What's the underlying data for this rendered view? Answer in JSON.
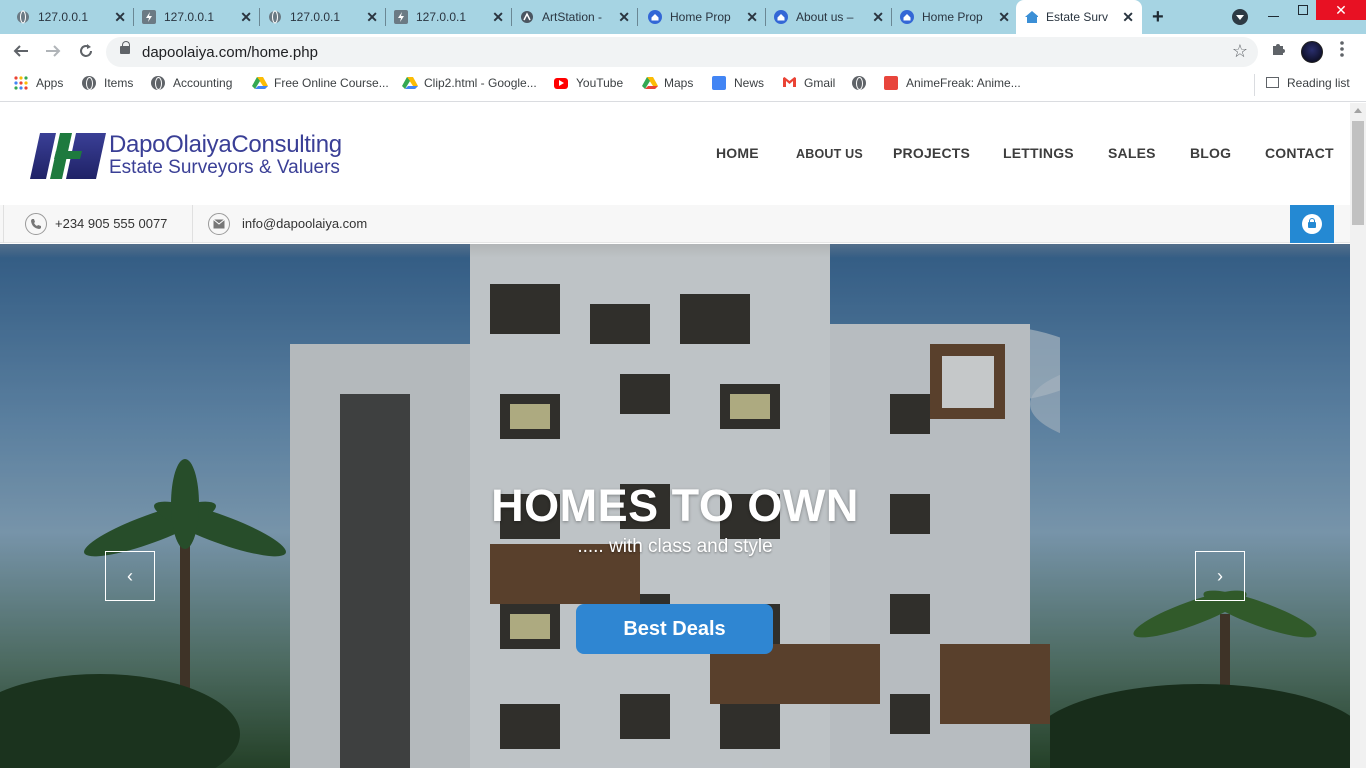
{
  "browser": {
    "tabs": [
      {
        "title": "127.0.0.1",
        "icon": "globe-icon"
      },
      {
        "title": "127.0.0.1",
        "icon": "lightning-icon"
      },
      {
        "title": "127.0.0.1",
        "icon": "globe-icon"
      },
      {
        "title": "127.0.0.1",
        "icon": "lightning-icon"
      },
      {
        "title": "ArtStation -",
        "icon": "artstation-icon"
      },
      {
        "title": "Home Prop",
        "icon": "home-app-icon"
      },
      {
        "title": "About us –",
        "icon": "home-app-icon"
      },
      {
        "title": "Home Prop",
        "icon": "home-app-icon"
      },
      {
        "title": "Estate Surv",
        "icon": "home-icon",
        "active": true
      }
    ],
    "close_symbol": "✕",
    "new_tab_symbol": "+",
    "url": "dapoolaiya.com/home.php",
    "bookmarks": [
      {
        "label": "Apps",
        "icon": "apps-grid-icon"
      },
      {
        "label": "Items",
        "icon": "globe-icon"
      },
      {
        "label": "Accounting",
        "icon": "globe-icon"
      },
      {
        "label": "Free Online Course...",
        "icon": "drive-icon"
      },
      {
        "label": "Clip2.html - Google...",
        "icon": "drive-icon"
      },
      {
        "label": "YouTube",
        "icon": "youtube-icon"
      },
      {
        "label": "Maps",
        "icon": "maps-icon"
      },
      {
        "label": "News",
        "icon": "news-icon"
      },
      {
        "label": "Gmail",
        "icon": "gmail-icon"
      },
      {
        "label": "",
        "icon": "globe-icon"
      },
      {
        "label": "AnimeFreak: Anime...",
        "icon": "animefreak-icon"
      }
    ],
    "reading_list": "Reading list"
  },
  "site": {
    "logo": {
      "line1": "DapoOlaiyaConsulting",
      "line2": "Estate Surveyors & Valuers"
    },
    "nav": [
      "HOME",
      "ABOUT US",
      "PROJECTS",
      "LETTINGS",
      "SALES",
      "BLOG",
      "CONTACT"
    ],
    "contact": {
      "phone": "+234 905 555 0077",
      "email": "info@dapoolaiya.com"
    },
    "hero": {
      "title": "HOMES TO OWN",
      "subtitle": "..... with class and style",
      "cta": "Best Deals",
      "prev": "‹",
      "next": "›"
    }
  },
  "colors": {
    "tab_strip": "#a6d4e3",
    "brand_blue": "#3a3f96",
    "brand_green": "#1e7a3e",
    "cta_blue": "#2f86d2",
    "login_blue": "#2489d3"
  }
}
